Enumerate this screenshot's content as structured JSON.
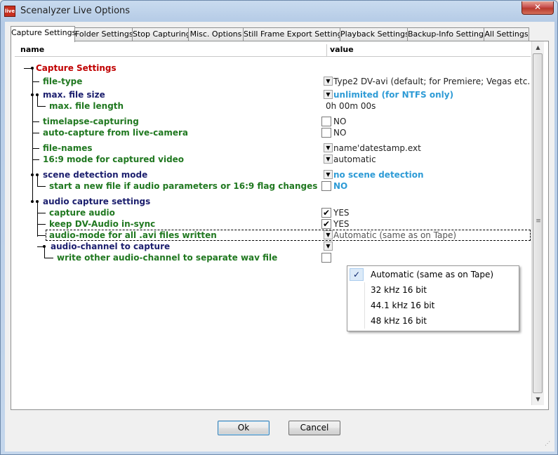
{
  "window": {
    "title": "Scenalyzer Live Options",
    "app_icon_text": "live",
    "close_glyph": "✕"
  },
  "tabs": [
    {
      "label": "Capture Settings",
      "active": true
    },
    {
      "label": "Folder Settings"
    },
    {
      "label": "Stop Capturing"
    },
    {
      "label": "Misc. Options"
    },
    {
      "label": "Still Frame Export Settings"
    },
    {
      "label": "Playback Settings"
    },
    {
      "label": "Backup-Info Settings"
    },
    {
      "label": "All Settings"
    }
  ],
  "grid": {
    "headers": {
      "name": "name",
      "value": "value"
    },
    "rows": [
      {
        "label": "Capture Settings",
        "value": ""
      },
      {
        "label": "file-type",
        "value": "Type2 DV-avi (default; for Premiere; Vegas etc.)",
        "control": "dropdown"
      },
      {
        "label": "max. file size",
        "value": "unlimited (for NTFS only)",
        "control": "dropdown"
      },
      {
        "label": "max. file length",
        "value": "0h 00m 00s",
        "control": "text"
      },
      {
        "label": "timelapse-capturing",
        "value": "NO",
        "control": "checkbox",
        "checked": false
      },
      {
        "label": "auto-capture from live-camera",
        "value": "NO",
        "control": "checkbox",
        "checked": false
      },
      {
        "label": "file-names",
        "value": "name'datestamp.ext",
        "control": "dropdown"
      },
      {
        "label": "16:9 mode for captured video",
        "value": "automatic",
        "control": "dropdown"
      },
      {
        "label": "scene detection mode",
        "value": "no scene detection",
        "control": "dropdown"
      },
      {
        "label": "start a new file if audio parameters or 16:9 flag changes",
        "value": "NO",
        "control": "checkbox",
        "checked": false
      },
      {
        "label": "audio capture settings",
        "value": ""
      },
      {
        "label": "capture audio",
        "value": "YES",
        "control": "checkbox",
        "checked": true
      },
      {
        "label": "keep DV-Audio in-sync",
        "value": "YES",
        "control": "checkbox",
        "checked": true
      },
      {
        "label": "audio-mode for all .avi files written",
        "value": "Automatic (same as on Tape)",
        "control": "dropdown",
        "focused": true
      },
      {
        "label": "audio-channel to capture",
        "value": "",
        "control": "dropdown"
      },
      {
        "label": "write other audio-channel to separate wav file",
        "value": "",
        "control": "checkbox",
        "checked": false
      }
    ]
  },
  "dropdown_popup": {
    "items": [
      "Automatic (same as on Tape)",
      "32 kHz 16 bit",
      "44.1 kHz 16 bit",
      "48 kHz 16 bit"
    ],
    "selected_index": 0,
    "check_glyph": "✓"
  },
  "icons": {
    "dropdown_arrow": "▼",
    "scroll_up": "▲",
    "scroll_down": "▼",
    "check": "✔"
  },
  "buttons": {
    "ok": "Ok",
    "cancel": "Cancel"
  }
}
